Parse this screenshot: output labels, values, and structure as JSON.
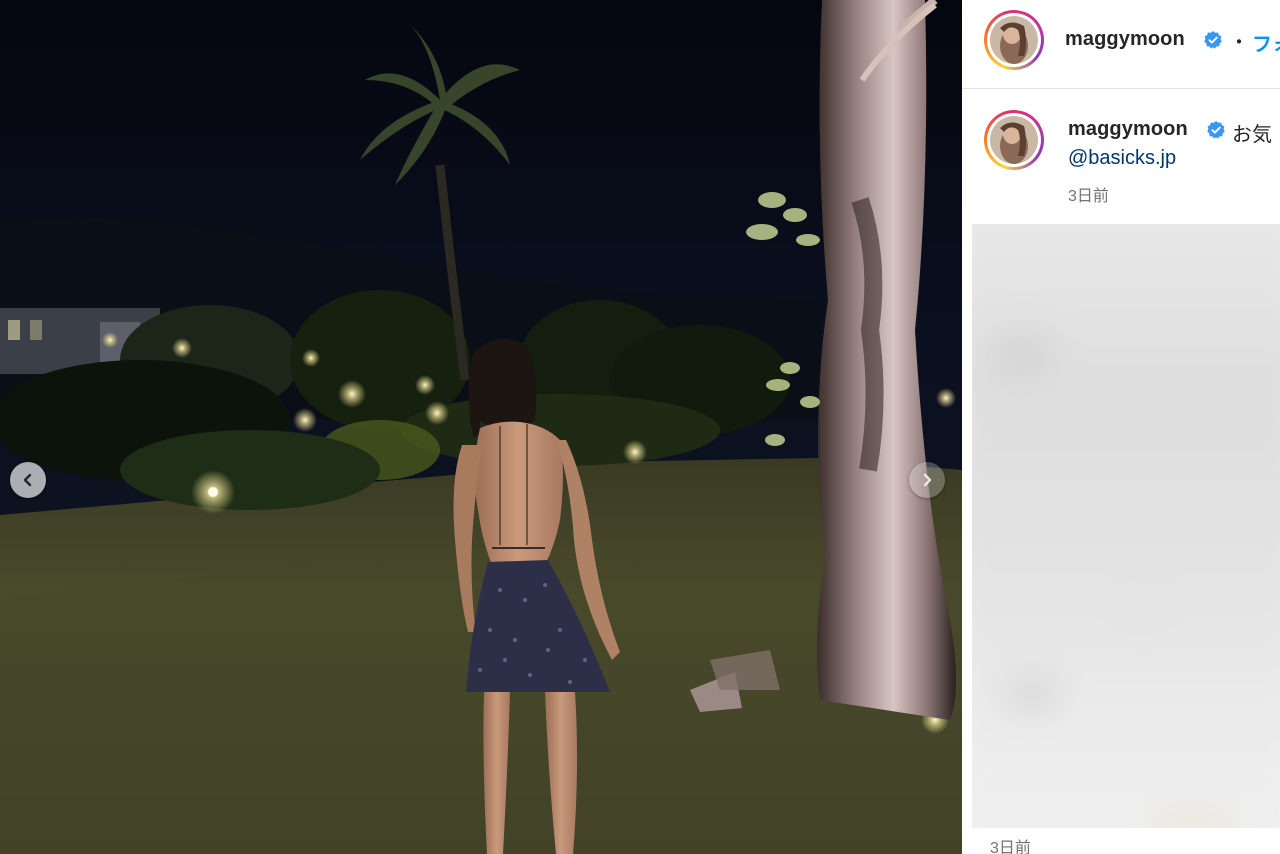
{
  "post": {
    "image_description_icon": "night-garden-photo",
    "prev_icon": "chevron-left-icon",
    "next_icon": "chevron-right-icon"
  },
  "header": {
    "username": "maggymoon",
    "separator": "・",
    "follow_label": "フォ"
  },
  "caption": {
    "username": "maggymoon",
    "text": "お気",
    "mention": "@basicks.jp",
    "time": "3日前"
  },
  "comment": {
    "time": "3日前"
  },
  "colors": {
    "verified": "#3897f0",
    "link": "#0095f6",
    "mention": "#00376b",
    "muted": "#737373"
  }
}
